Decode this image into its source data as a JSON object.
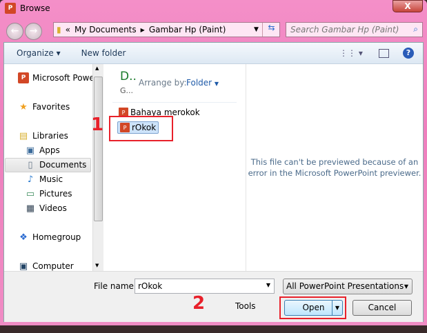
{
  "window": {
    "title": "Browse",
    "close": "X"
  },
  "address": {
    "prefix": "«",
    "crumbs": [
      "My Documents",
      "Gambar Hp (Paint)"
    ]
  },
  "search": {
    "placeholder": "Search Gambar Hp (Paint)"
  },
  "toolbar": {
    "organize": "Organize ▾",
    "new_folder": "New folder"
  },
  "nav": {
    "items": [
      {
        "label": "Microsoft PowerPoint",
        "icon": "powerpoint-icon"
      },
      {
        "label": "Favorites",
        "icon": "star-icon"
      },
      {
        "label": "Libraries",
        "icon": "libraries-icon"
      },
      {
        "label": "Apps",
        "icon": "apps-icon"
      },
      {
        "label": "Documents",
        "icon": "documents-icon"
      },
      {
        "label": "Music",
        "icon": "music-icon"
      },
      {
        "label": "Pictures",
        "icon": "pictures-icon"
      },
      {
        "label": "Videos",
        "icon": "videos-icon"
      },
      {
        "label": "Homegroup",
        "icon": "homegroup-icon"
      },
      {
        "label": "Computer",
        "icon": "computer-icon"
      }
    ]
  },
  "library": {
    "title": "D..",
    "subtitle": "G...",
    "arrange_label": "Arrange by:",
    "arrange_value": "Folder"
  },
  "files": [
    "Bahaya merokok",
    "rOkok"
  ],
  "preview": {
    "message": "This file can't be previewed because of an error in the Microsoft PowerPoint previewer."
  },
  "bottom": {
    "file_name_label": "File name:",
    "file_name_value": "rOkok",
    "file_type": "All PowerPoint Presentations",
    "tools": "Tools",
    "open": "Open",
    "cancel": "Cancel"
  },
  "annotations": {
    "step1": "1",
    "step2": "2"
  }
}
